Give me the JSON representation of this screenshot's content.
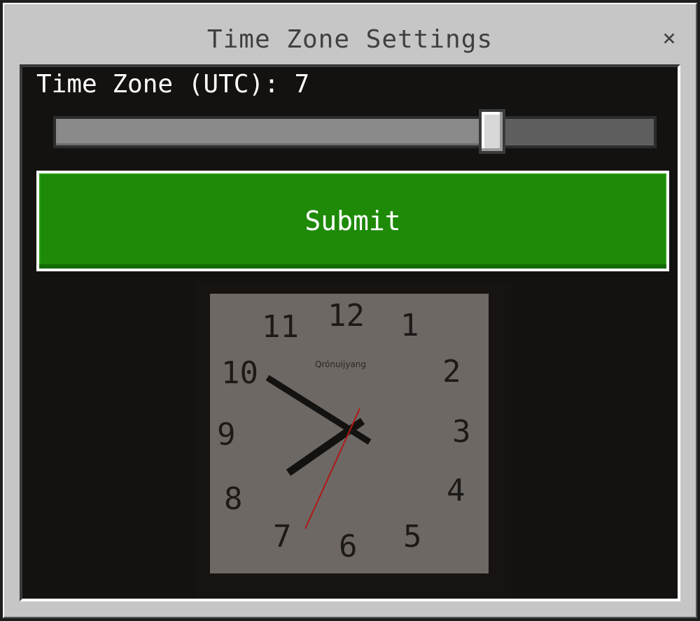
{
  "dialog": {
    "title": "Time Zone Settings",
    "close_glyph": "×"
  },
  "timezone": {
    "label": "Time Zone (UTC): 7",
    "slider_fraction": 0.73
  },
  "submit": {
    "label": "Submit",
    "color": "#1e8a08"
  },
  "clock": {
    "numbers": [
      "12",
      "1",
      "2",
      "3",
      "4",
      "5",
      "6",
      "7",
      "8",
      "9",
      "10",
      "11"
    ],
    "brand": "Qrónuijyang"
  }
}
